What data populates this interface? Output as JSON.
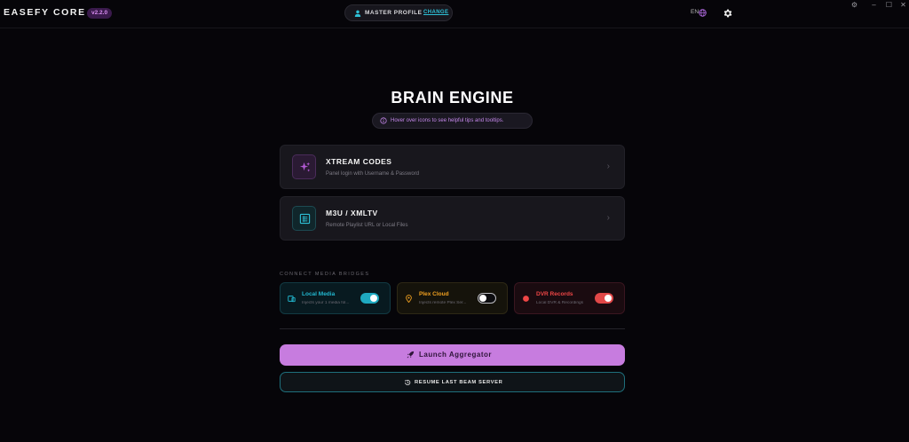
{
  "app": {
    "brand": "EASEFY CORE",
    "version": "v2.2.0"
  },
  "header": {
    "profile_label": "MASTER PROFILE",
    "profile_change": "CHANGE",
    "language": "EN",
    "icons": [
      "user-icon",
      "globe-icon",
      "gear-icon"
    ],
    "window_controls": [
      "settings-icon",
      "minimize-icon",
      "maximize-icon",
      "close-icon"
    ]
  },
  "main": {
    "title": "BRAIN ENGINE",
    "tip": "Hover over icons to see helpful tips and tooltips."
  },
  "cards": [
    {
      "title": "XTREAM CODES",
      "subtitle": "Panel login with Username & Password",
      "icon": "sparkles-icon",
      "accent": "#b45ad6"
    },
    {
      "title": "M3U / XMLTV",
      "subtitle": "Remote Playlist URL or Local Files",
      "icon": "list-icon",
      "accent": "#2ec0d6"
    }
  ],
  "bridges": {
    "label": "CONNECT MEDIA BRIDGES",
    "items": [
      {
        "name": "Local Media",
        "desc": "Injects your 1 media fol...",
        "on": true,
        "color": "#22b8d0"
      },
      {
        "name": "Plex Cloud",
        "desc": "Injects remote Plex Ser...",
        "on": false,
        "color": "#f0a020"
      },
      {
        "name": "DVR Records",
        "desc": "Local DVR & Recordings",
        "on": true,
        "color": "#ef4646"
      }
    ]
  },
  "actions": {
    "launch": "Launch Aggregator",
    "resume": "RESUME LAST BEAM SERVER"
  },
  "colors": {
    "background": "#060509",
    "accent_purple": "#c77cdf",
    "accent_cyan": "#2ec0d6"
  }
}
